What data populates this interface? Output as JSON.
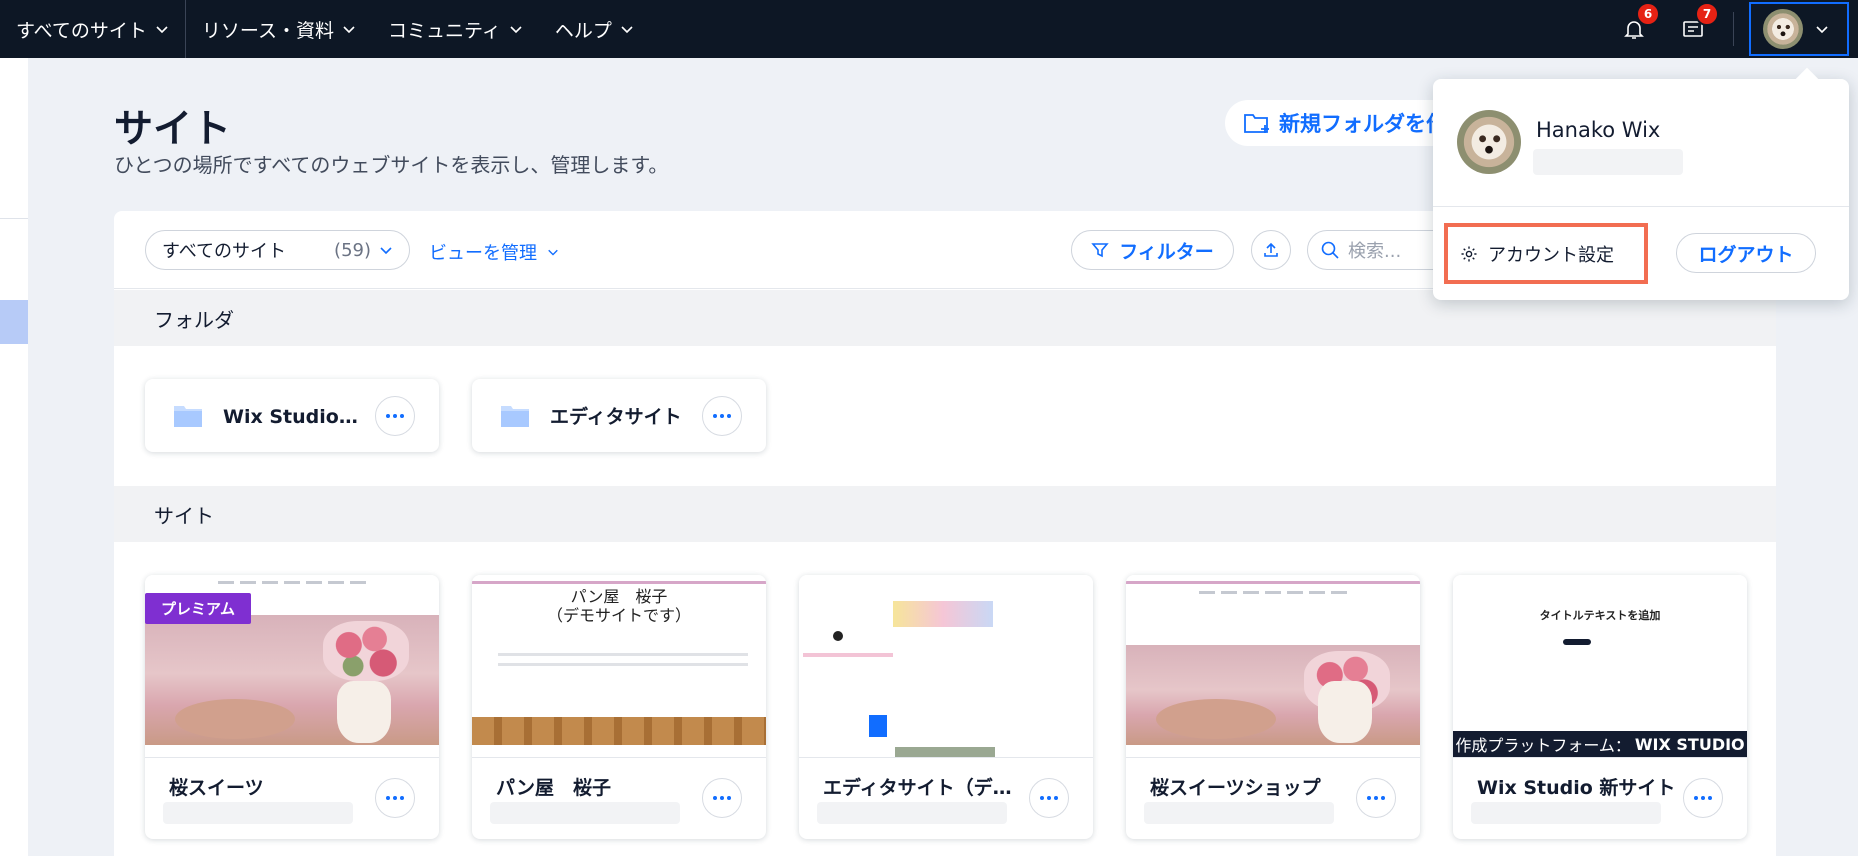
{
  "topnav": {
    "items": [
      {
        "label": "すべてのサイト"
      },
      {
        "label": "リソース・資料"
      },
      {
        "label": "コミュニティ"
      },
      {
        "label": "ヘルプ"
      }
    ],
    "notifications_count": "6",
    "messages_count": "7"
  },
  "header": {
    "title": "サイト",
    "subtitle": "ひとつの場所ですべてのウェブサイトを表示し、管理します。",
    "new_folder_label": "新規フォルダを作成"
  },
  "toolbar": {
    "view_label": "すべてのサイト",
    "view_count": "(59)",
    "manage_views_label": "ビューを管理",
    "filter_label": "フィルター",
    "search_placeholder": "検索..."
  },
  "folders": {
    "heading": "フォルダ",
    "items": [
      {
        "name": "Wix Studio サイト"
      },
      {
        "name": "エディタサイト"
      }
    ]
  },
  "sites": {
    "heading": "サイト",
    "items": [
      {
        "name": "桜スイーツ",
        "badge": "プレミアム"
      },
      {
        "name": "パン屋　桜子",
        "thumb_title": "パン屋　桜子",
        "thumb_subtitle": "（デモサイトです）"
      },
      {
        "name": "エディタサイト（デモ）"
      },
      {
        "name": "桜スイーツショップ"
      },
      {
        "name": "Wix Studio 新サイト",
        "thumb_title": "タイトルテキストを追加",
        "strip_label": "作成プラットフォーム：",
        "strip_brand": "WIX STUDIO"
      }
    ]
  },
  "account_menu": {
    "user_name": "Hanako Wix",
    "account_settings_label": "アカウント設定",
    "logout_label": "ログアウト"
  },
  "colors": {
    "topbar": "#0d1725",
    "accent": "#116dff",
    "premium": "#7f2fd1",
    "highlight": "#f26d51",
    "badge": "#e62214"
  }
}
